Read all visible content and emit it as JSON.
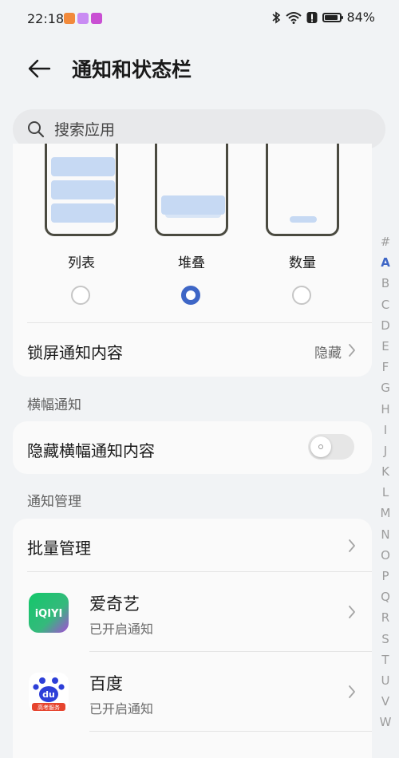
{
  "status": {
    "time": "22:18",
    "battery": "84%",
    "battery_level": 0.84,
    "notif_icons": [
      "#f28a3b",
      "#c98bf3",
      "#c94fd3"
    ]
  },
  "header": {
    "title": "通知和状态栏"
  },
  "search": {
    "placeholder": "搜索应用"
  },
  "styles": [
    {
      "label": "列表",
      "selected": false
    },
    {
      "label": "堆叠",
      "selected": true
    },
    {
      "label": "数量",
      "selected": false
    }
  ],
  "lockscreen": {
    "label": "锁屏通知内容",
    "value": "隐藏"
  },
  "banner": {
    "section_title": "横幅通知",
    "hide_label": "隐藏横幅通知内容",
    "hide_enabled": false
  },
  "manage": {
    "section_title": "通知管理",
    "batch_label": "批量管理",
    "apps": [
      {
        "name": "爱奇艺",
        "status": "已开启通知",
        "icon_text": "iQIYI"
      },
      {
        "name": "百度",
        "status": "已开启通知",
        "icon_text": "du",
        "icon_caption": "高考服务"
      }
    ]
  },
  "index_letters": [
    "#",
    "A",
    "B",
    "C",
    "D",
    "E",
    "F",
    "G",
    "H",
    "I",
    "J",
    "K",
    "L",
    "M",
    "N",
    "O",
    "P",
    "Q",
    "R",
    "S",
    "T",
    "U",
    "V",
    "W"
  ],
  "index_active": "A",
  "colors": {
    "accent": "#3e66c6",
    "bar": "#c6d9f3"
  }
}
